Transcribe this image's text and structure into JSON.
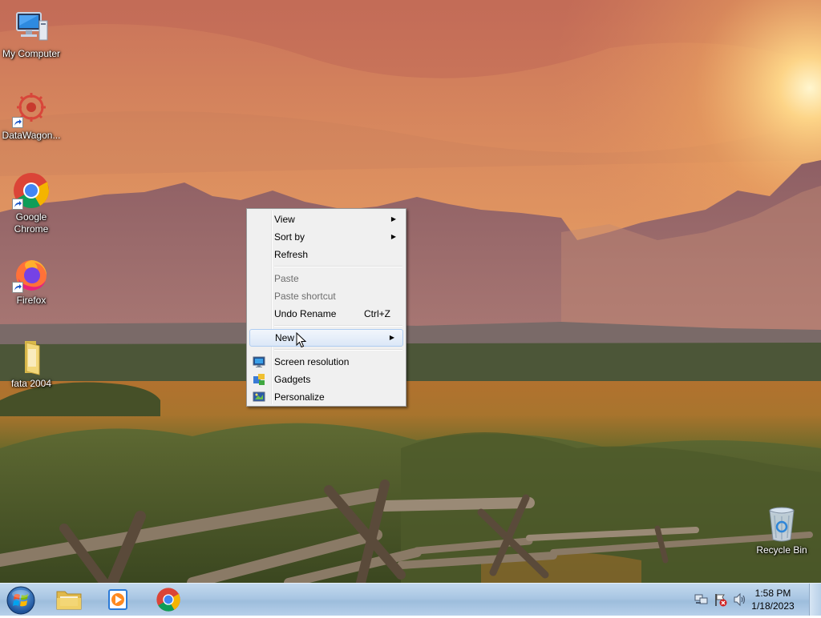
{
  "desktop": {
    "icons": [
      {
        "label": "My Computer",
        "icon": "computer-icon"
      },
      {
        "label": "DataWagon...",
        "icon": "datawagon-icon"
      },
      {
        "label": "Google Chrome",
        "icon": "chrome-icon"
      },
      {
        "label": "Firefox",
        "icon": "firefox-icon"
      },
      {
        "label": "fata 2004",
        "icon": "folder-icon"
      },
      {
        "label": "Recycle Bin",
        "icon": "recycle-bin-icon"
      }
    ]
  },
  "context_menu": {
    "items": [
      {
        "label": "View",
        "submenu": true
      },
      {
        "label": "Sort by",
        "submenu": true
      },
      {
        "label": "Refresh"
      },
      {
        "label": "Paste",
        "disabled": true
      },
      {
        "label": "Paste shortcut",
        "disabled": true
      },
      {
        "label": "Undo Rename",
        "shortcut": "Ctrl+Z"
      },
      {
        "label": "New",
        "submenu": true,
        "highlighted": true
      },
      {
        "label": "Screen resolution",
        "icon": "screen-resolution-icon"
      },
      {
        "label": "Gadgets",
        "icon": "gadgets-icon"
      },
      {
        "label": "Personalize",
        "icon": "personalize-icon"
      }
    ],
    "submenu_arrow": "▶"
  },
  "taskbar": {
    "start": {
      "icon": "windows-start-icon"
    },
    "pinned": [
      {
        "icon": "file-explorer-icon"
      },
      {
        "icon": "media-player-icon"
      },
      {
        "icon": "chrome-icon"
      }
    ],
    "tray": [
      {
        "icon": "network-icon"
      },
      {
        "icon": "action-center-flag-icon"
      },
      {
        "icon": "volume-icon"
      }
    ],
    "clock": {
      "time": "1:58 PM",
      "date": "1/18/2023"
    }
  },
  "colors": {
    "menu_highlight_border": "#aeccf1",
    "taskbar": "#a9c6e3"
  }
}
